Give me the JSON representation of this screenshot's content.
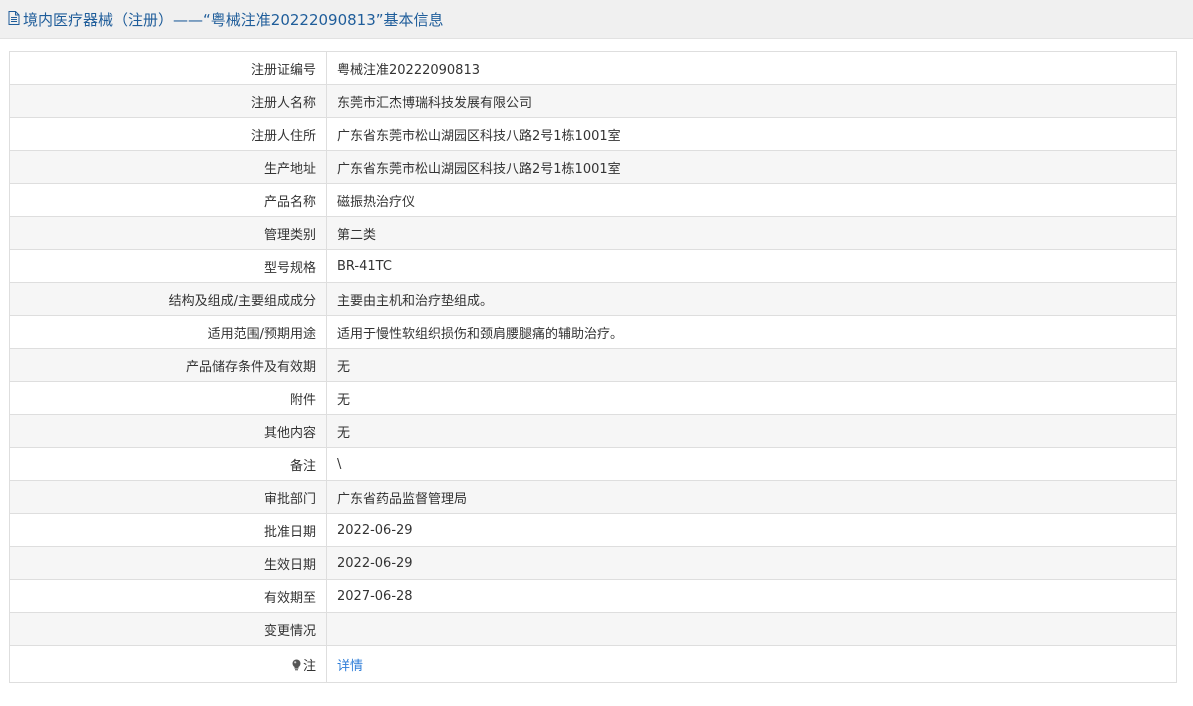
{
  "header": {
    "title": "境内医疗器械（注册）——“粤械注准20222090813”基本信息",
    "icon": "document-icon"
  },
  "rows": [
    {
      "label": "注册证编号",
      "value": "粤械注准20222090813"
    },
    {
      "label": "注册人名称",
      "value": "东莞市汇杰博瑞科技发展有限公司"
    },
    {
      "label": "注册人住所",
      "value": "广东省东莞市松山湖园区科技八路2号1栋1001室"
    },
    {
      "label": "生产地址",
      "value": "广东省东莞市松山湖园区科技八路2号1栋1001室"
    },
    {
      "label": "产品名称",
      "value": "磁振热治疗仪"
    },
    {
      "label": "管理类别",
      "value": "第二类"
    },
    {
      "label": "型号规格",
      "value": "BR-41TC"
    },
    {
      "label": "结构及组成/主要组成成分",
      "value": "主要由主机和治疗垫组成。"
    },
    {
      "label": "适用范围/预期用途",
      "value": "适用于慢性软组织损伤和颈肩腰腿痛的辅助治疗。"
    },
    {
      "label": "产品储存条件及有效期",
      "value": "无"
    },
    {
      "label": "附件",
      "value": "无"
    },
    {
      "label": "其他内容",
      "value": "无"
    },
    {
      "label": "备注",
      "value": "\\"
    },
    {
      "label": "审批部门",
      "value": "广东省药品监督管理局"
    },
    {
      "label": "批准日期",
      "value": "2022-06-29"
    },
    {
      "label": "生效日期",
      "value": "2022-06-29"
    },
    {
      "label": "有效期至",
      "value": "2027-06-28"
    },
    {
      "label": "变更情况",
      "value": ""
    }
  ],
  "note": {
    "label": "注",
    "icon": "lightbulb-icon",
    "link_text": "详情"
  },
  "colors": {
    "title_text": "#1f5d9a",
    "title_bg": "#f0f0f0",
    "link": "#2f7ed8",
    "row_alt_bg": "#f6f6f6",
    "border": "#dedede"
  }
}
